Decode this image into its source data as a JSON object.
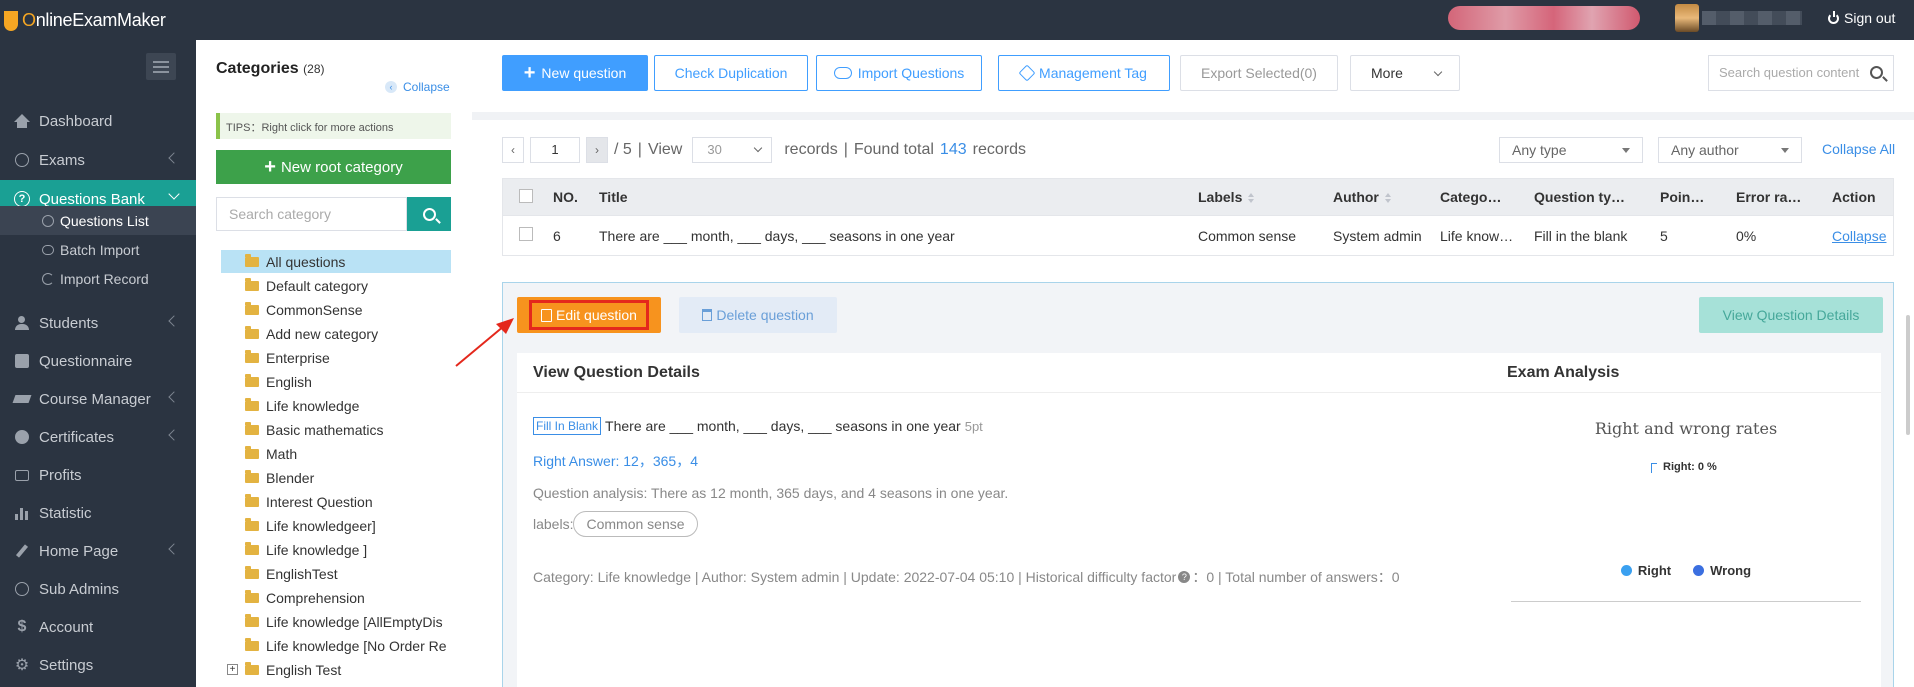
{
  "app": {
    "logo_prefix": "O",
    "logo_rest": "nlineExamMaker",
    "sign_out": "Sign out"
  },
  "sidebar": {
    "items": [
      {
        "label": "Dashboard",
        "icon": "home-icon"
      },
      {
        "label": "Exams",
        "icon": "check-circle-icon"
      },
      {
        "label": "Questions Bank",
        "icon": "question-circle-icon",
        "active": true
      },
      {
        "label": "Students",
        "icon": "user-icon"
      },
      {
        "label": "Questionnaire",
        "icon": "checkbox-icon"
      },
      {
        "label": "Course Manager",
        "icon": "graduation-cap-icon"
      },
      {
        "label": "Certificates",
        "icon": "certificate-icon"
      },
      {
        "label": "Profits",
        "icon": "card-icon"
      },
      {
        "label": "Statistic",
        "icon": "bar-chart-icon"
      },
      {
        "label": "Home Page",
        "icon": "pen-icon"
      },
      {
        "label": "Sub Admins",
        "icon": "question-circle-icon"
      },
      {
        "label": "Account",
        "icon": "dollar-icon"
      },
      {
        "label": "Settings",
        "icon": "gear-icon"
      }
    ],
    "sub_items": [
      {
        "label": "Questions List",
        "icon": "question-icon"
      },
      {
        "label": "Batch Import",
        "icon": "cloud-icon"
      },
      {
        "label": "Import Record",
        "icon": "history-icon"
      }
    ]
  },
  "categories": {
    "title": "Categories",
    "count": "(28)",
    "collapse": "Collapse",
    "tips": "TIPS：Right click for more actions",
    "new_root": "New root category",
    "search_placeholder": "Search category",
    "tree": [
      "All questions",
      "Default category",
      "CommonSense",
      "Add new category",
      "Enterprise",
      "English",
      "Life knowledge",
      "Basic mathematics",
      "Math",
      "Blender",
      "Interest Question",
      "Life knowledgeer]",
      "Life knowledge ]",
      "EnglishTest",
      "Comprehension",
      "Life knowledge [AllEmptyDis",
      "Life knowledge [No Order Re",
      "English Test"
    ],
    "expander": "+"
  },
  "toolbar": {
    "new_question": "New question",
    "check_duplication": "Check Duplication",
    "import_questions": "Import Questions",
    "management_tag": "Management Tag",
    "export_selected": "Export Selected(0)",
    "more": "More",
    "search_placeholder": "Search question content"
  },
  "pager": {
    "page": "1",
    "total_pages": "/ 5",
    "view": "View",
    "per_page": "30",
    "records": "records",
    "sep": "|",
    "found_prefix": "Found total",
    "found_count": "143",
    "found_suffix": "records",
    "type_filter": "Any type",
    "author_filter": "Any author",
    "collapse_all": "Collapse All"
  },
  "table": {
    "headers": [
      "NO.",
      "Title",
      "Labels",
      "Author",
      "Catego…",
      "Question ty…",
      "Poin…",
      "Error ra…",
      "Action"
    ],
    "rows": [
      {
        "no": "6",
        "title": "There are ___ month, ___ days, ___ seasons in one year",
        "labels": "Common sense",
        "author": "System admin",
        "category": "Life know…",
        "type": "Fill in the blank",
        "points": "5",
        "error_rate": "0%",
        "action": "Collapse"
      }
    ]
  },
  "detail": {
    "edit": "Edit question",
    "delete": "Delete question",
    "view_details": "View Question Details",
    "card_title": "View Question Details",
    "badge": "Fill In Blank",
    "question": "There are ___ month, ___ days, ___ seasons in one year",
    "points": "5pt",
    "answer": "Right Answer: 12，365，4",
    "analysis": "Question analysis: There as 12 month, 365 days, and 4 seasons in one year.",
    "labels_prefix": "labels:",
    "label_pill": "Common sense",
    "meta_main": "Category: Life knowledge | Author: System admin | Update: 2022-07-04 05:10 | Historical difficulty factor",
    "meta_diff": "：0 | Total number of answers：0",
    "analysis_title": "Exam Analysis"
  },
  "chart_data": {
    "type": "pie",
    "title": "Right and wrong rates",
    "categories": [
      "Right",
      "Wrong"
    ],
    "values": [
      0,
      0
    ],
    "data_labels": [
      "Right: 0 %"
    ],
    "colors": {
      "Right": "#3aa0f0",
      "Wrong": "#3b6fe0"
    },
    "legend_position": "bottom"
  },
  "colors": {
    "sidebar_bg": "#2b3441",
    "active_teal": "#1aa094",
    "primary_blue": "#409eff",
    "edit_orange": "#f7931e",
    "annotation_red": "#e4281c"
  }
}
